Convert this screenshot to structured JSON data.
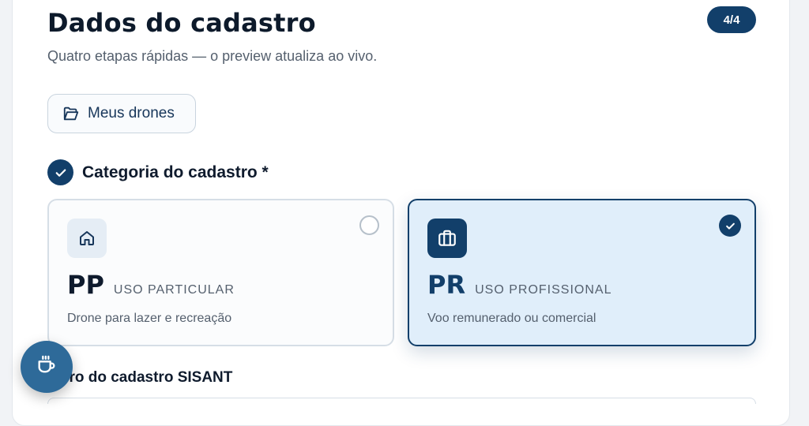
{
  "header": {
    "title": "Dados do cadastro",
    "subtitle": "Quatro etapas rápidas — o preview atualiza ao vivo.",
    "step_badge": "4/4"
  },
  "toolbar": {
    "my_drones_label": "Meus drones",
    "my_drones_icon": "folder-open-icon"
  },
  "category": {
    "title": "Categoria do cadastro *",
    "status_icon": "check-circle-icon",
    "options": [
      {
        "code": "PP",
        "name": "USO PARTICULAR",
        "description": "Drone para lazer e recreação",
        "icon": "home-icon",
        "selected": false
      },
      {
        "code": "PR",
        "name": "USO PROFISSIONAL",
        "description": "Voo remunerado ou comercial",
        "icon": "briefcase-icon",
        "selected": true
      }
    ]
  },
  "sisant": {
    "label": "mero do cadastro SISANT"
  },
  "fab": {
    "icon": "coffee-cup-icon"
  },
  "colors": {
    "primary": "#123f6a",
    "selected_bg": "#e0eefa",
    "fab_bg": "#2e6a99"
  }
}
